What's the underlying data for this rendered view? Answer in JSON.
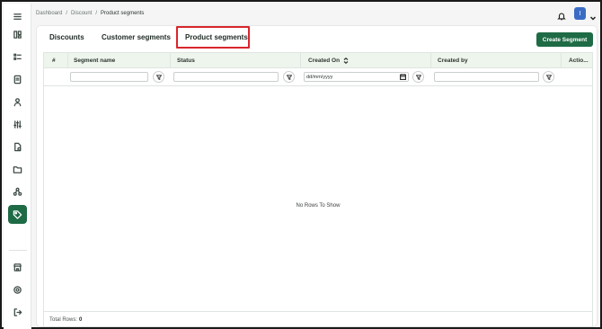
{
  "breadcrumb": [
    "Dashboard",
    "Discount",
    "Product segments"
  ],
  "breadcrumb_separator": "/",
  "user": {
    "avatar_initial": "I"
  },
  "tabs": [
    {
      "label": "Discounts",
      "active": false
    },
    {
      "label": "Customer segments",
      "active": false
    },
    {
      "label": "Product segments",
      "active": true
    }
  ],
  "create_button_label": "Create Segment",
  "grid": {
    "columns": [
      "#",
      "Segment name",
      "Status",
      "Created On",
      "Created by",
      "Actio..."
    ],
    "date_filter_placeholder": "dd/mm/yyyy",
    "empty_message": "No Rows To Show",
    "footer_label": "Total Rows:",
    "total_rows": "0"
  },
  "sidebar": {
    "items": [
      "menu-icon",
      "dashboard-icon",
      "list-icon",
      "orders-icon",
      "customers-icon",
      "sliders-icon",
      "file-icon",
      "folder-icon",
      "network-icon",
      "tag-icon",
      "store-icon",
      "settings-icon",
      "logout-icon"
    ],
    "active_item": "tag-icon"
  },
  "colors": {
    "accent": "#1e6b45",
    "header_bg": "#edf5ec",
    "highlight_border": "#d8262c",
    "avatar_bg": "#3b6cc4"
  }
}
